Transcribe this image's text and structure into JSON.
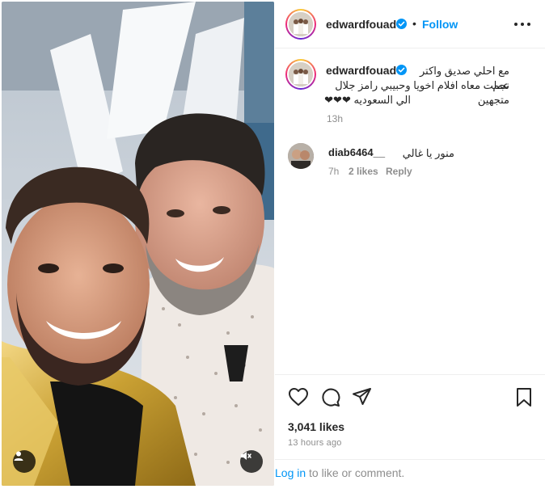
{
  "post": {
    "author": "edwardfouad",
    "follow_label": "Follow",
    "separator": "•"
  },
  "caption": {
    "username": "edwardfouad",
    "line1": "مع احلي صديق واكتر نجم",
    "line2": "عملت معاه افلام اخويا وحبيبي رامز جلال متجهين",
    "line3": "الي السعوديه ❤❤❤",
    "time": "13h"
  },
  "comments": [
    {
      "username": "diab6464__",
      "text": "منور يا غالي",
      "time": "7h",
      "likes": "2 likes",
      "reply_label": "Reply"
    }
  ],
  "stats": {
    "likes": "3,041 likes",
    "ago": "13 hours ago"
  },
  "login": {
    "link": "Log in",
    "rest": " to like or comment."
  },
  "icons": {
    "like": "heart-icon",
    "comment": "comment-icon",
    "share": "share-icon",
    "save": "bookmark-icon",
    "more": "more-icon",
    "verified": "verified-badge-icon",
    "user_tag": "user-tag-icon",
    "mute": "mute-icon"
  },
  "colors": {
    "accent": "#0095f6",
    "verified": "#0095f6",
    "text": "#262626",
    "muted": "#8e8e8e"
  }
}
